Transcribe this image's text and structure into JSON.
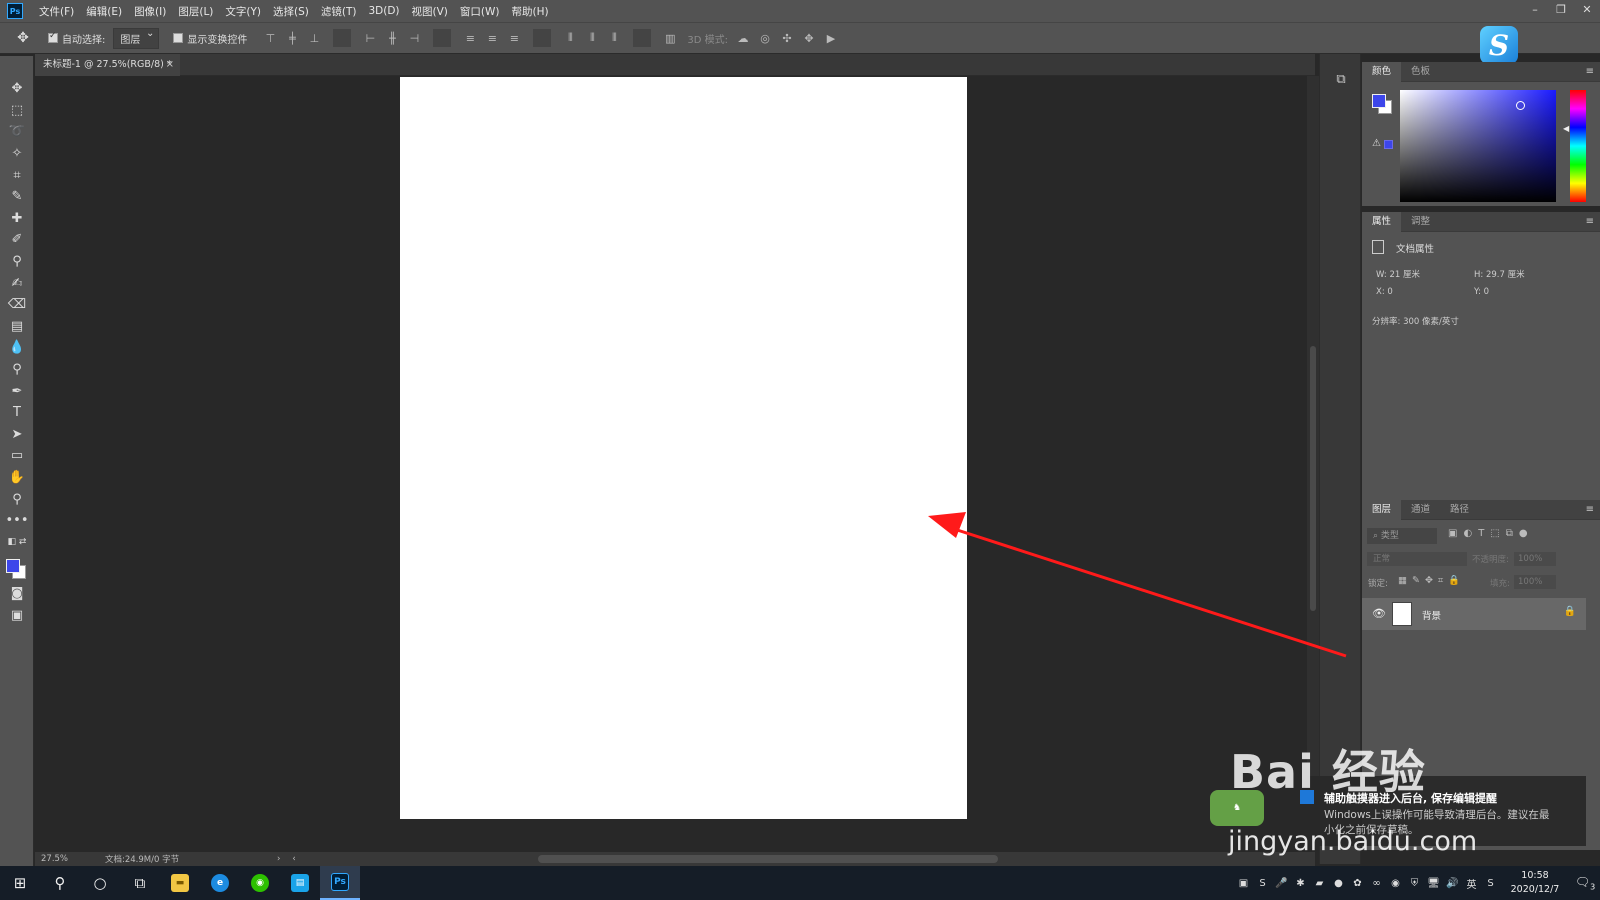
{
  "menubar": {
    "logo": "Ps",
    "items": [
      "文件(F)",
      "编辑(E)",
      "图像(I)",
      "图层(L)",
      "文字(Y)",
      "选择(S)",
      "滤镜(T)",
      "3D(D)",
      "视图(V)",
      "窗口(W)",
      "帮助(H)"
    ],
    "window_controls": [
      "–",
      "❐",
      "✕"
    ]
  },
  "optionsbar": {
    "auto_select_label": "自动选择:",
    "auto_select_checked": true,
    "auto_select_target": "图层",
    "show_transform_label": "显示变换控件",
    "show_transform_checked": false,
    "mode_3d_label": "3D 模式:"
  },
  "document": {
    "tab_title": "未标题-1 @ 27.5%(RGB/8) *",
    "tab_close": "×"
  },
  "statusbar": {
    "zoom": "27.5%",
    "doc_info": "文档:24.9M/0 字节"
  },
  "colors": {
    "foreground": "#3d46ea",
    "background": "#ffffff",
    "annotation_arrow": "#ff1a1a"
  },
  "color_panel": {
    "tabs": [
      "颜色",
      "色板"
    ],
    "active_tab": 0
  },
  "properties_panel": {
    "tabs": [
      "属性",
      "调整"
    ],
    "active_tab": 0,
    "title": "文档属性",
    "width": "W:  21 厘米",
    "height": "H:  29.7 厘米",
    "x": "X:  0",
    "y": "Y:  0",
    "resolution": "分辨率: 300 像素/英寸"
  },
  "layers_panel": {
    "tabs": [
      "图层",
      "通道",
      "路径"
    ],
    "active_tab": 0,
    "filter_placeholder": "⌕ 类型",
    "blend_mode": "正常",
    "opacity_label": "不透明度:",
    "opacity_value": "100%",
    "lock_label": "锁定:",
    "fill_label": "填充:",
    "fill_value": "100%",
    "layers": [
      {
        "name": "背景",
        "visible": true,
        "locked": true
      }
    ]
  },
  "notification": {
    "title": "辅助触摸器进入后台, 保存编辑提醒",
    "body": "Windows上误操作可能导致清理后台。建议在最小化之前保存草稿。"
  },
  "watermark": {
    "brand": "Bai 经验",
    "url": "jingyan.baidu.com"
  },
  "taskbar": {
    "apps": [
      "windows",
      "search",
      "cortana",
      "task-view",
      "file-explorer",
      "edge",
      "wechat",
      "store",
      "photoshop"
    ],
    "active_app": "photoshop",
    "time": "10:58",
    "date": "2020/12/7",
    "ime": "英",
    "notification_count": "3"
  }
}
